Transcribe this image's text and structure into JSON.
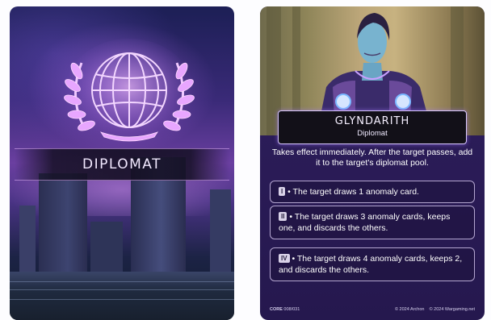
{
  "left_card": {
    "title": "DIPLOMAT",
    "emblem_icon": "globe-laurel-icon"
  },
  "right_card": {
    "character_name": "GLYNDARITH",
    "character_class": "Diplomat",
    "effect": "Takes effect immediately. After the target passes, add it to the target's diplomat pool.",
    "tiers": [
      {
        "badge": "I",
        "text": "• The target draws 1 anomaly card."
      },
      {
        "badge": "II",
        "text": "• The target draws 3 anomaly cards, keeps one, and discards the others."
      },
      {
        "badge": "IV",
        "text": "• The target draws 4 anomaly cards, keeps 2, and discards the others."
      }
    ],
    "footer": {
      "set_code": "CORE",
      "card_number": "008/031",
      "copyright_1": "© 2024 Archon",
      "copyright_2": "© 2024 Wargaming.net"
    }
  },
  "colors": {
    "plate_border": "#d7c6ff",
    "card_bg": "#2a1f5a",
    "emblem_glow": "#e0a8ff"
  }
}
